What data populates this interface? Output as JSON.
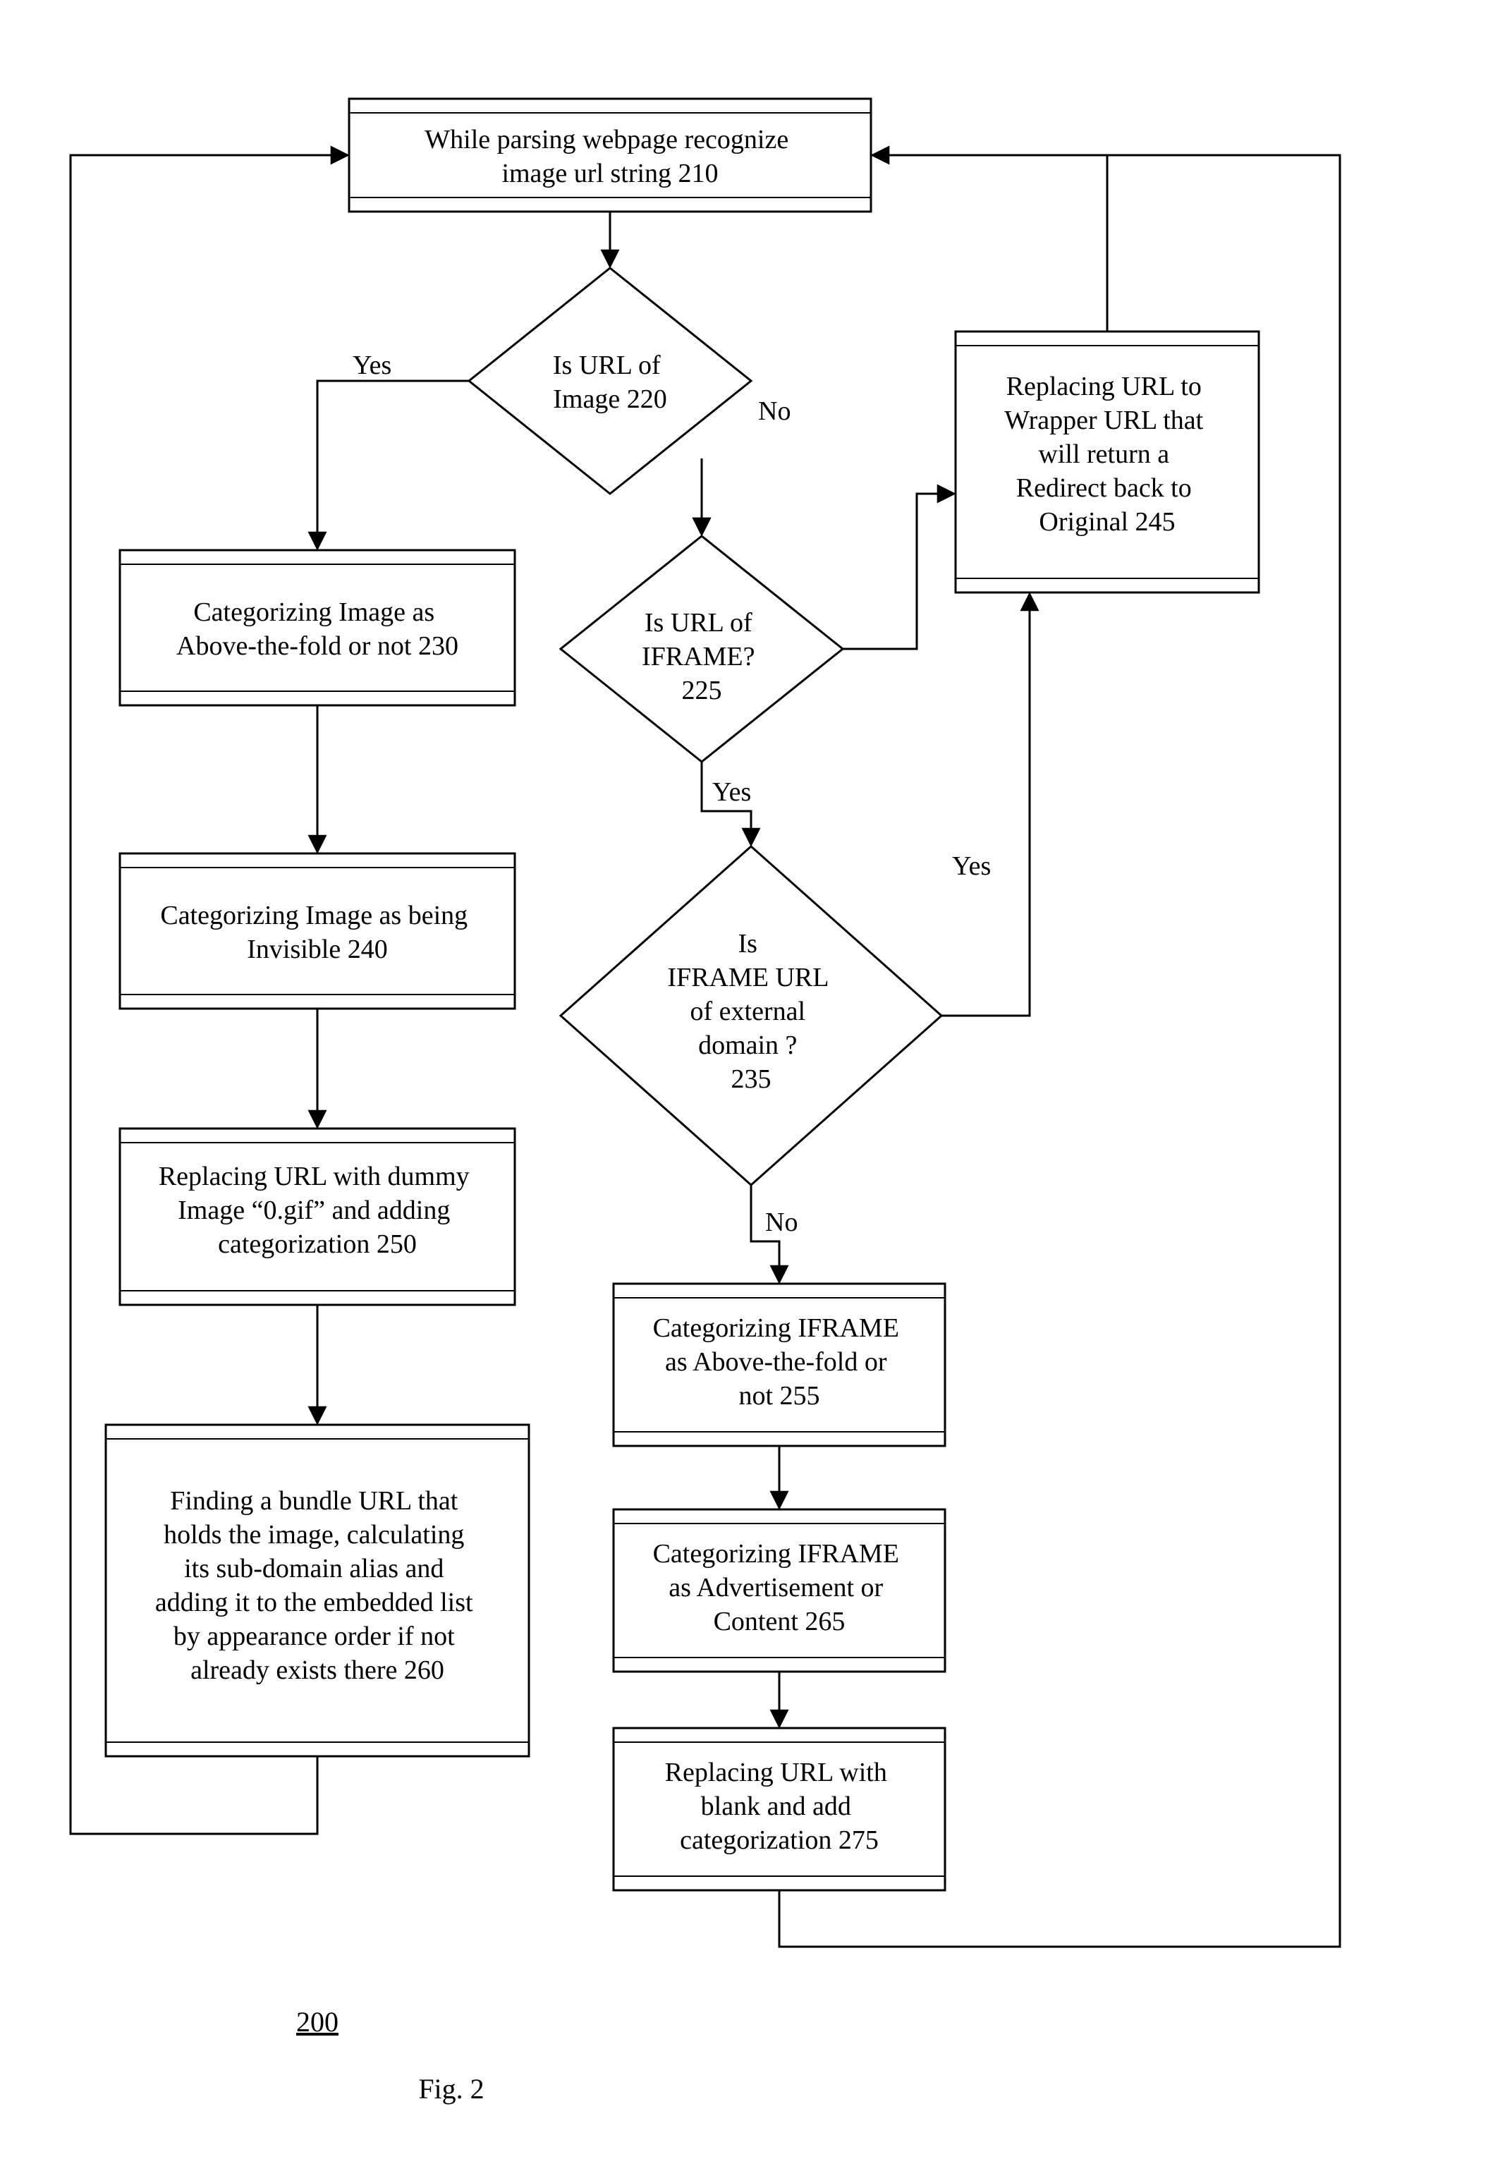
{
  "figure_number": "200",
  "figure_label": "Fig. 2",
  "nodes": {
    "n210": {
      "lines": [
        "While parsing webpage recognize",
        "image url string 210"
      ]
    },
    "n220": {
      "lines": [
        "Is URL of",
        "Image 220"
      ]
    },
    "n225": {
      "lines": [
        "Is URL of",
        "IFRAME?",
        "225"
      ]
    },
    "n230": {
      "lines": [
        "Categorizing Image as",
        "Above-the-fold or not 230"
      ]
    },
    "n235": {
      "lines": [
        "Is",
        "IFRAME URL",
        "of external",
        "domain ?",
        "235"
      ]
    },
    "n240": {
      "lines": [
        "Categorizing Image as being",
        "Invisible 240"
      ]
    },
    "n245": {
      "lines": [
        "Replacing URL to",
        "Wrapper URL that",
        "will return a",
        "Redirect back to",
        "Original 245"
      ]
    },
    "n250": {
      "lines": [
        "Replacing URL with dummy",
        "Image “0.gif” and adding",
        "categorization 250"
      ]
    },
    "n255": {
      "lines": [
        "Categorizing IFRAME",
        "as Above-the-fold or",
        "not 255"
      ]
    },
    "n260": {
      "lines": [
        "Finding a bundle URL that",
        "holds the image, calculating",
        "its sub-domain alias and",
        "adding it to the embedded list",
        "by appearance order if not",
        "already exists there 260"
      ]
    },
    "n265": {
      "lines": [
        "Categorizing IFRAME",
        "as Advertisement or",
        "Content 265"
      ]
    },
    "n275": {
      "lines": [
        "Replacing URL with",
        "blank and add",
        "categorization 275"
      ]
    }
  },
  "edges": {
    "e220_yes": "Yes",
    "e220_no": "No",
    "e225_yes": "Yes",
    "e235_yes": "Yes",
    "e235_no": "No"
  },
  "chart_data": {
    "type": "flowchart",
    "title": "Fig. 2",
    "reference_number": "200",
    "nodes": [
      {
        "id": "210",
        "shape": "process",
        "text": "While parsing webpage recognize image url string 210"
      },
      {
        "id": "220",
        "shape": "decision",
        "text": "Is URL of Image 220"
      },
      {
        "id": "225",
        "shape": "decision",
        "text": "Is URL of IFRAME? 225"
      },
      {
        "id": "230",
        "shape": "process",
        "text": "Categorizing Image as Above-the-fold or not 230"
      },
      {
        "id": "235",
        "shape": "decision",
        "text": "Is IFRAME URL of external domain ? 235"
      },
      {
        "id": "240",
        "shape": "process",
        "text": "Categorizing Image as being Invisible 240"
      },
      {
        "id": "245",
        "shape": "process",
        "text": "Replacing URL to Wrapper URL that will return a Redirect back to Original 245"
      },
      {
        "id": "250",
        "shape": "process",
        "text": "Replacing URL with dummy Image “0.gif” and adding categorization 250"
      },
      {
        "id": "255",
        "shape": "process",
        "text": "Categorizing IFRAME as Above-the-fold or not 255"
      },
      {
        "id": "260",
        "shape": "process",
        "text": "Finding a bundle URL that holds the image, calculating its sub-domain alias and adding it to the embedded list by appearance order if not already exists there 260"
      },
      {
        "id": "265",
        "shape": "process",
        "text": "Categorizing IFRAME as Advertisement or Content 265"
      },
      {
        "id": "275",
        "shape": "process",
        "text": "Replacing URL with blank and add categorization 275"
      }
    ],
    "edges": [
      {
        "from": "210",
        "to": "220",
        "label": ""
      },
      {
        "from": "220",
        "to": "230",
        "label": "Yes"
      },
      {
        "from": "220",
        "to": "225",
        "label": "No"
      },
      {
        "from": "225",
        "to": "235",
        "label": "Yes"
      },
      {
        "from": "225",
        "to": "245",
        "label": ""
      },
      {
        "from": "230",
        "to": "240",
        "label": ""
      },
      {
        "from": "235",
        "to": "245",
        "label": "Yes"
      },
      {
        "from": "235",
        "to": "255",
        "label": "No"
      },
      {
        "from": "240",
        "to": "250",
        "label": ""
      },
      {
        "from": "245",
        "to": "210",
        "label": ""
      },
      {
        "from": "250",
        "to": "260",
        "label": ""
      },
      {
        "from": "255",
        "to": "265",
        "label": ""
      },
      {
        "from": "260",
        "to": "210",
        "label": ""
      },
      {
        "from": "265",
        "to": "275",
        "label": ""
      },
      {
        "from": "275",
        "to": "210",
        "label": ""
      }
    ]
  }
}
